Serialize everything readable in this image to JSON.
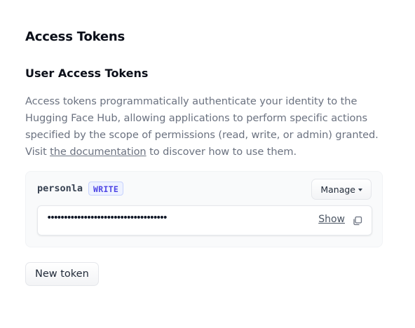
{
  "page": {
    "title": "Access Tokens"
  },
  "section": {
    "title": "User Access Tokens",
    "description_before": "Access tokens programmatically authenticate your identity to the Hugging Face Hub, allowing applications to perform specific actions specified by the scope of permissions (read, write, or admin) granted. Visit ",
    "description_link": "the documentation",
    "description_after": " to discover how to use them."
  },
  "token": {
    "name": "personla",
    "role_badge": "WRITE",
    "manage_label": "Manage",
    "masked_value": "••••••••••••••••••••••••••••••••••••",
    "show_label": "Show",
    "copy_icon": "copy-icon"
  },
  "actions": {
    "new_token_label": "New token"
  },
  "colors": {
    "badge_text": "#4f46e5",
    "badge_bg": "#eef2ff",
    "muted_text": "#6b7280",
    "card_bg": "#f9fafb"
  }
}
